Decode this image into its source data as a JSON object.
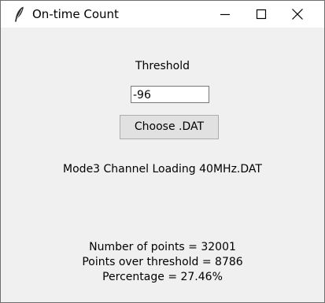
{
  "window": {
    "title": "On-time Count",
    "icons": {
      "app": "feather-icon",
      "minimize": "minimize-icon",
      "maximize": "maximize-icon",
      "close": "close-icon"
    }
  },
  "form": {
    "threshold_label": "Threshold",
    "threshold_value": "-96",
    "choose_button_label": "Choose .DAT",
    "loaded_file_label": "Mode3 Channel Loading 40MHz.DAT"
  },
  "results": {
    "number_of_points": "Number of points = 32001",
    "points_over_threshold": "Points over threshold = 8786",
    "percentage": "Percentage = 27.46%"
  }
}
